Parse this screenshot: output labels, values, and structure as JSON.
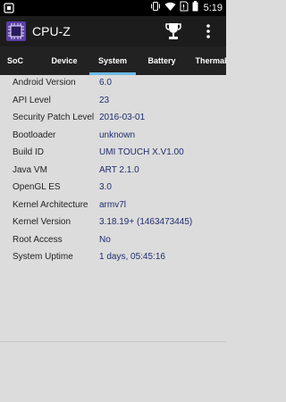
{
  "status_bar": {
    "time": "5:19",
    "icons": [
      "app-icon",
      "vibrate-icon",
      "wifi-icon",
      "no-sim-icon",
      "battery-icon"
    ]
  },
  "app_bar": {
    "title": "CPU-Z",
    "icons": [
      "cpu-icon",
      "trophy-icon",
      "overflow-menu-icon"
    ]
  },
  "tabs": {
    "items": [
      "SoC",
      "Device",
      "System",
      "Battery",
      "Thermal"
    ],
    "selected": "System",
    "indicator_color": "#6db9e6"
  },
  "system_info": [
    {
      "label": "Android Version",
      "value": "6.0"
    },
    {
      "label": "API Level",
      "value": "23"
    },
    {
      "label": "Security Patch Level",
      "value": "2016-03-01"
    },
    {
      "label": "Bootloader",
      "value": "unknown"
    },
    {
      "label": "Build ID",
      "value": "UMI TOUCH X.V1.00"
    },
    {
      "label": "Java VM",
      "value": "ART 2.1.0"
    },
    {
      "label": "OpenGL ES",
      "value": "3.0"
    },
    {
      "label": "Kernel Architecture",
      "value": "armv7l"
    },
    {
      "label": "Kernel Version",
      "value": "3.18.19+ (1463473445)"
    },
    {
      "label": "Root Access",
      "value": "No"
    },
    {
      "label": "System Uptime",
      "value": "1 days, 05:45:16"
    }
  ],
  "colors": {
    "background": "#dcdcdc",
    "app_bar": "#1c1c1c",
    "tab_bar": "#222222",
    "value_text": "#1f2d6e"
  }
}
